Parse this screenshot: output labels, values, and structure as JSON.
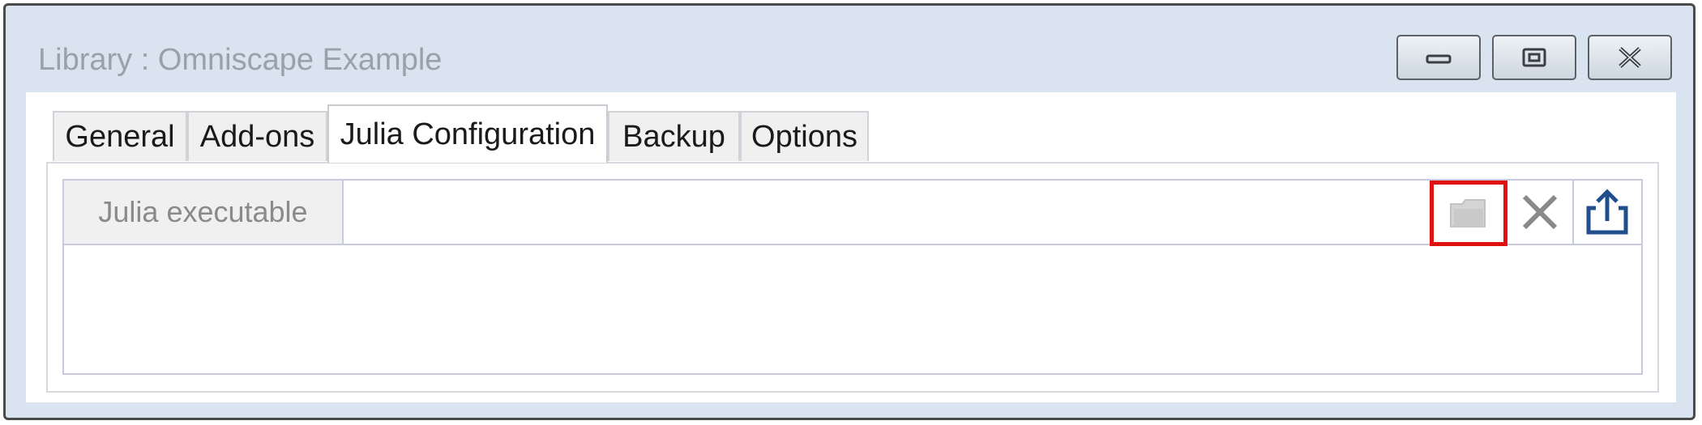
{
  "window": {
    "title": "Library : Omniscape Example",
    "controls": [
      "minimize-icon",
      "restore-icon",
      "close-icon"
    ]
  },
  "tabs": [
    {
      "label": "General",
      "active": false
    },
    {
      "label": "Add-ons",
      "active": false
    },
    {
      "label": "Julia Configuration",
      "active": true
    },
    {
      "label": "Backup",
      "active": false
    },
    {
      "label": "Options",
      "active": false
    }
  ],
  "julia_config": {
    "row_label": "Julia executable",
    "value": "",
    "actions": [
      {
        "icon": "folder-icon",
        "highlighted": true,
        "disabled": true
      },
      {
        "icon": "delete-x-icon",
        "disabled": true
      },
      {
        "icon": "export-icon",
        "disabled": false
      }
    ]
  },
  "colors": {
    "highlight": "#e01010",
    "title_text": "#9aa1a8",
    "export_icon": "#1f4e8c"
  }
}
